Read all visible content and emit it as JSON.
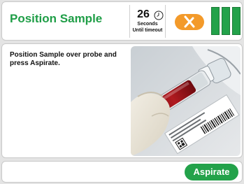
{
  "header": {
    "title": "Position Sample",
    "timeout": {
      "count": "26",
      "unit": "Seconds",
      "caption": "Until timeout"
    },
    "cancel_icon": "close-x-icon",
    "status_bars": {
      "count": 3,
      "color": "#23a24a"
    }
  },
  "main": {
    "instruction": "Position Sample over probe and press Aspirate.",
    "image": "blood-sample-tube-photo"
  },
  "footer": {
    "aspirate_label": "Aspirate"
  },
  "colors": {
    "title": "#1f9e47",
    "accent_green": "#23a24a",
    "cancel_orange": "#f39a2a",
    "background": "#e4e4e4"
  }
}
